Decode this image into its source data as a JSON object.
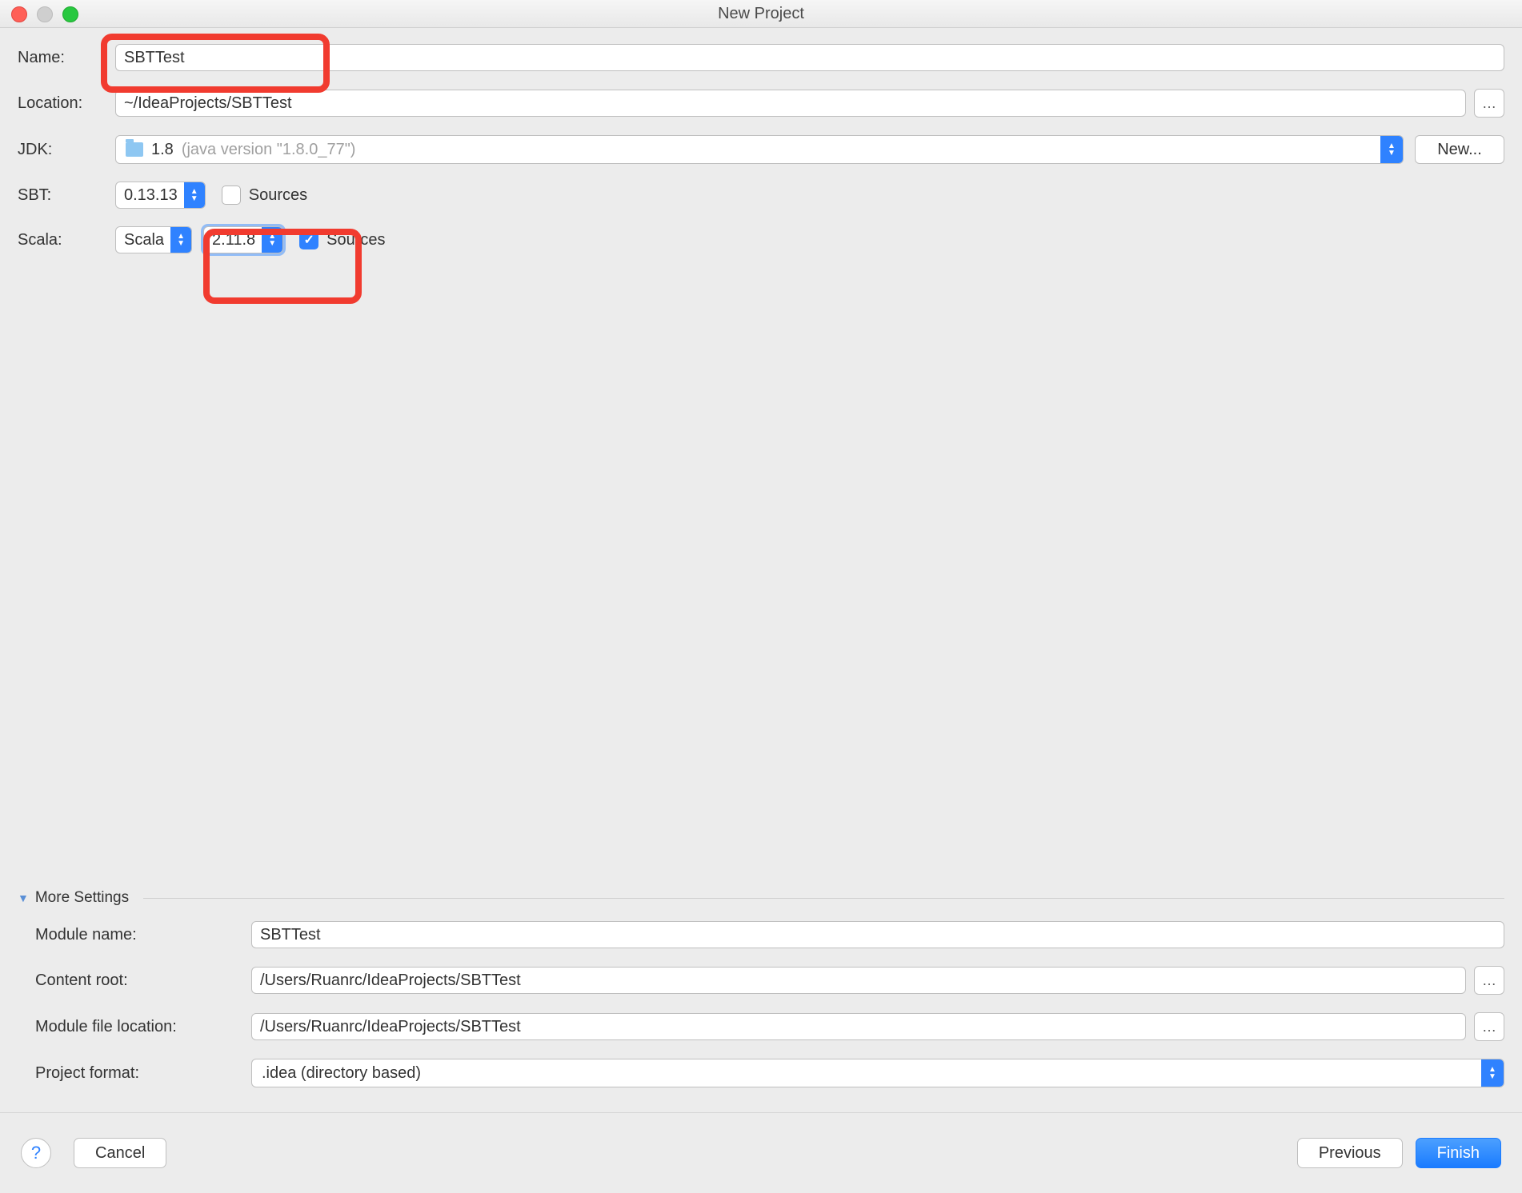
{
  "window": {
    "title": "New Project"
  },
  "labels": {
    "name": "Name:",
    "location": "Location:",
    "jdk": "JDK:",
    "sbt": "SBT:",
    "scala": "Scala:",
    "more_settings": "More Settings",
    "module_name": "Module name:",
    "content_root": "Content root:",
    "module_file_location": "Module file location:",
    "project_format": "Project format:"
  },
  "fields": {
    "name_value": "SBTTest",
    "location_value": "~/IdeaProjects/SBTTest",
    "jdk_version": "1.8",
    "jdk_detail": "(java version \"1.8.0_77\")",
    "sbt_version": "0.13.13",
    "scala_platform": "Scala",
    "scala_version": "2.11.8",
    "module_name_value": "SBTTest",
    "content_root_value": "/Users/Ruanrc/IdeaProjects/SBTTest",
    "module_file_location_value": "/Users/Ruanrc/IdeaProjects/SBTTest",
    "project_format_value": ".idea (directory based)"
  },
  "checkboxes": {
    "sbt_sources_label": "Sources",
    "sbt_sources_checked": false,
    "scala_sources_label": "Sources",
    "scala_sources_checked": true
  },
  "buttons": {
    "new": "New...",
    "browse": "…",
    "help": "?",
    "cancel": "Cancel",
    "previous": "Previous",
    "finish": "Finish"
  }
}
